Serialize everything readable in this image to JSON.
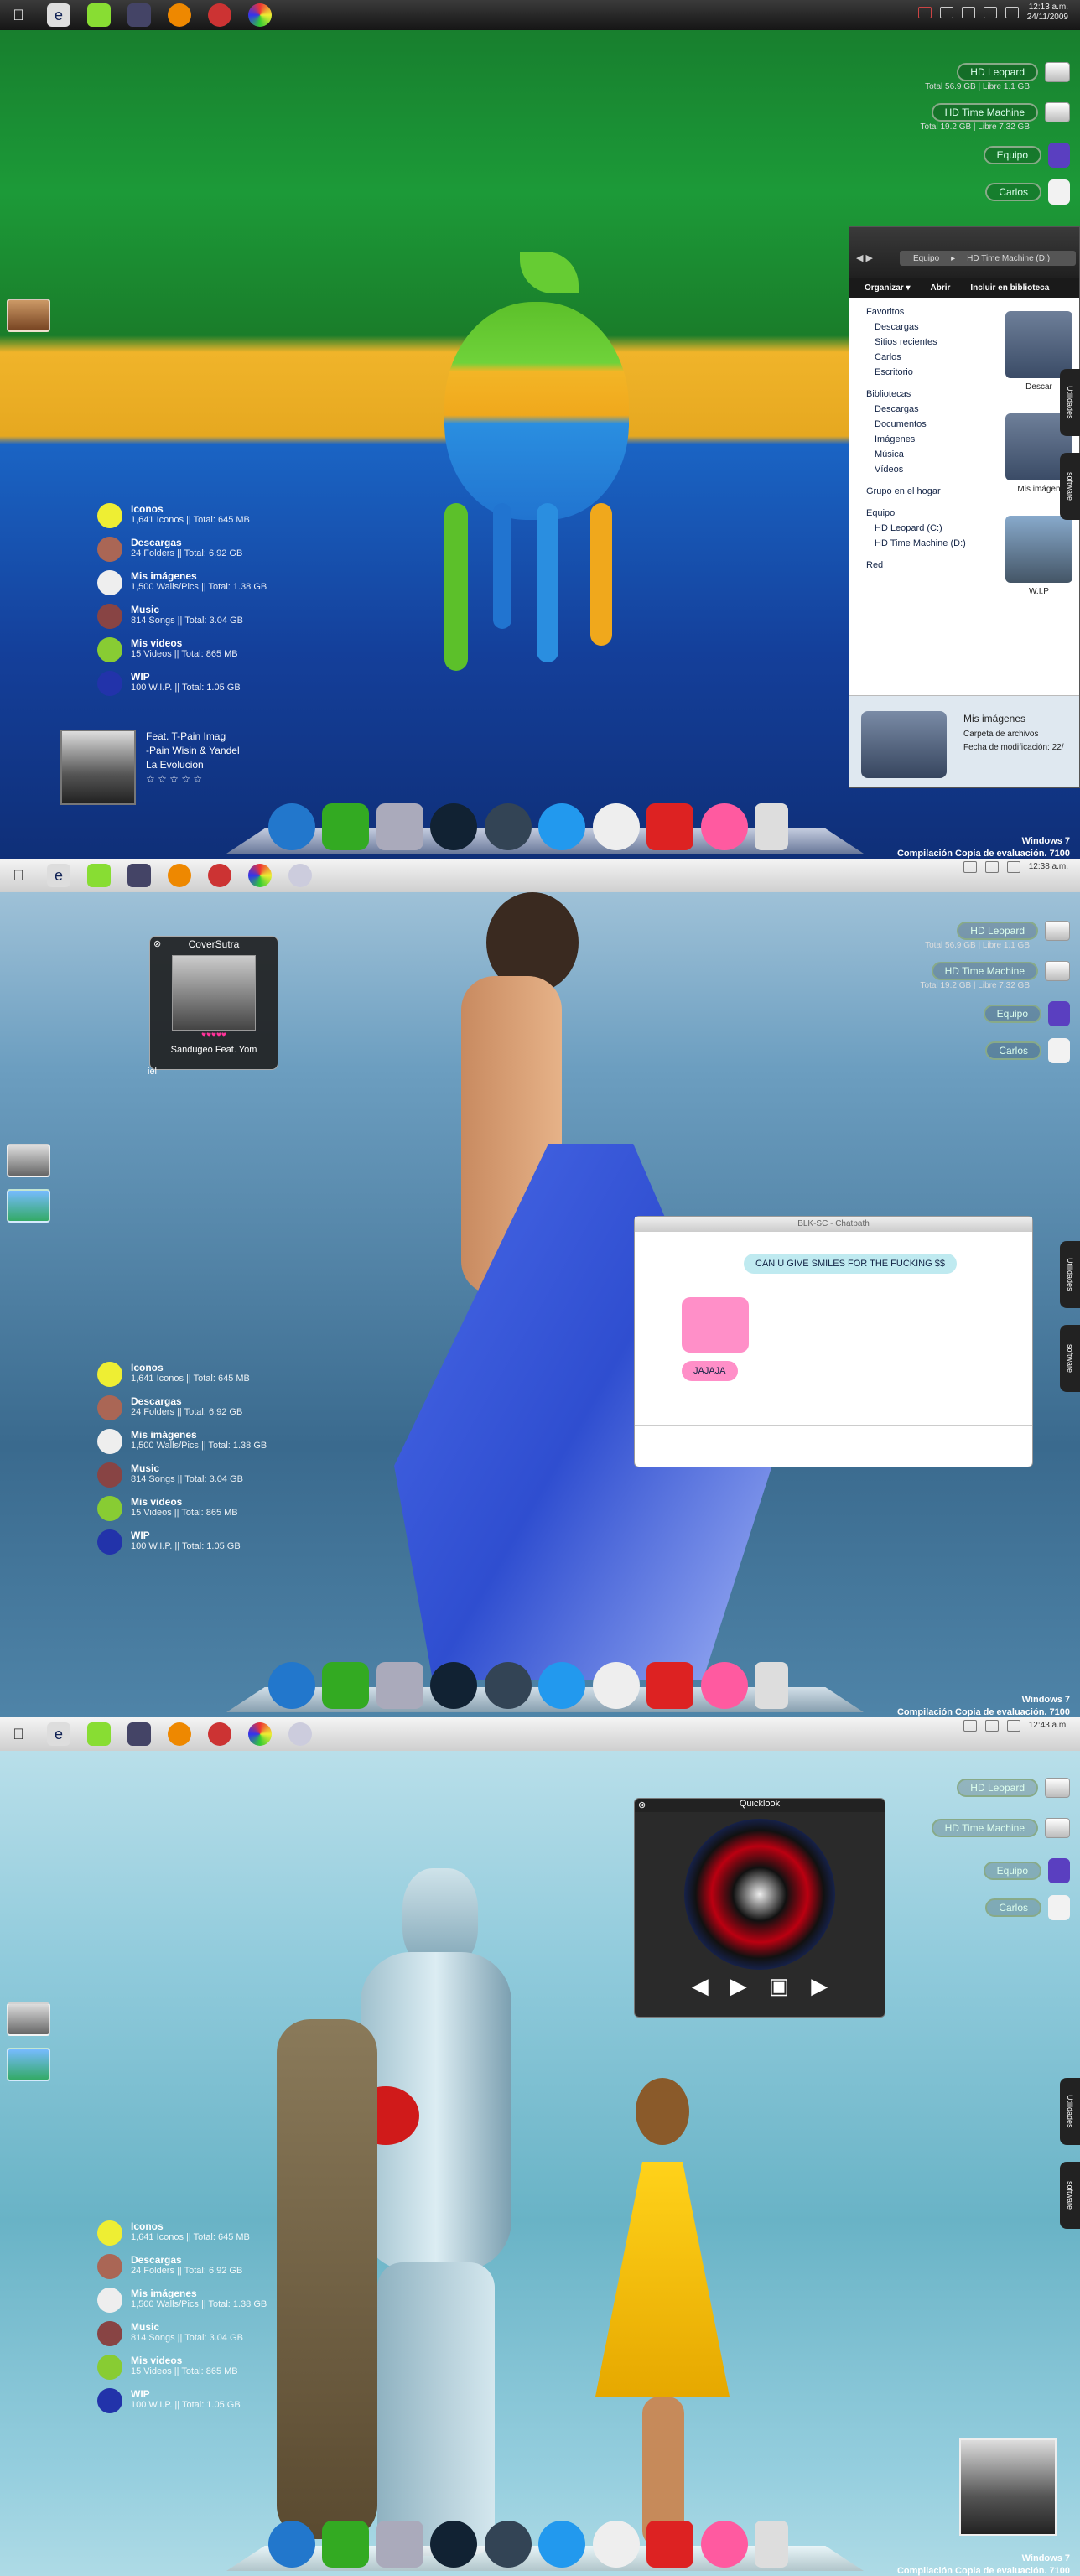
{
  "menubar": {
    "apple_icon": "apple-icon",
    "app_icons": [
      "ie-icon",
      "notes-icon",
      "monitor-icon",
      "firefox-icon",
      "chrome-icon",
      "pinwheel-icon"
    ]
  },
  "screen1": {
    "clock_time": "12:13 a.m.",
    "clock_date": "24/11/2009",
    "drives": [
      {
        "name": "HD Leopard",
        "sub": "Total 56.9 GB | Libre 1.1 GB"
      },
      {
        "name": "HD Time Machine",
        "sub": "Total 19.2 GB | Libre 7.32 GB"
      }
    ],
    "users": [
      "Equipo",
      "Carlos"
    ],
    "stats": [
      {
        "title": "Iconos",
        "detail": "1,641 Iconos || Total: 645 MB",
        "icon": "bulb-icon"
      },
      {
        "title": "Descargas",
        "detail": "24 Folders || Total: 6.92 GB",
        "icon": "download-icon"
      },
      {
        "title": "Mis imágenes",
        "detail": "1,500 Walls/Pics || Total: 1.38 GB",
        "icon": "images-icon"
      },
      {
        "title": "Music",
        "detail": "814 Songs || Total: 3.04 GB",
        "icon": "music-icon"
      },
      {
        "title": "Mis videos",
        "detail": "15 Videos || Total: 865 MB",
        "icon": "video-icon"
      },
      {
        "title": "WIP",
        "detail": "100 W.I.P. || Total: 1.05 GB",
        "icon": "wip-icon"
      }
    ],
    "music": {
      "line1": "Feat. T-Pain    Imag",
      "line2": "-Pain    Wisin & Yandel",
      "line3": "La Evolucion",
      "rating": "☆ ☆ ☆ ☆ ☆"
    },
    "explorer": {
      "addr_a": "Equipo",
      "addr_b": "HD Time Machine (D:)",
      "toolbar": [
        "Organizar ▾",
        "Abrir",
        "Incluir en biblioteca"
      ],
      "nav_favorites": "Favoritos",
      "favorites": [
        "Descargas",
        "Sitios recientes",
        "Carlos",
        "Escritorio"
      ],
      "nav_libraries": "Bibliotecas",
      "libraries": [
        "Descargas",
        "Documentos",
        "Imágenes",
        "Música",
        "Vídeos"
      ],
      "homegroup": "Grupo en el hogar",
      "nav_computer": "Equipo",
      "computer": [
        "HD Leopard (C:)",
        "HD Time Machine (D:)"
      ],
      "network": "Red",
      "files": [
        "Descar",
        "Mis imágen",
        "W.I.P"
      ],
      "detail_name": "Mis imágenes",
      "detail_type": "Carpeta de archivos",
      "detail_date": "Fecha de modificación: 22/"
    },
    "watermark_1": "Windows 7",
    "watermark_2": "Compilación Copia de evaluación. 7100",
    "side_tabs": [
      "Utilidades",
      "software"
    ]
  },
  "screen2": {
    "clock_time": "12:38 a.m.",
    "coversutra": {
      "title": "CoverSutra",
      "subtitle": "Sandugeo Feat. Yom",
      "left": "iel"
    },
    "chat": {
      "title": "BLK-SC - Chatpath",
      "msg1": "CAN U GIVE SMILES FOR THE FUCKING $$",
      "msg2": "JAJAJA"
    }
  },
  "screen3": {
    "clock_time": "12:43 a.m.",
    "quicklook": {
      "title": "Quicklook"
    }
  },
  "dock": [
    "face-icon",
    "hat-icon",
    "robot-icon",
    "compass-icon",
    "safari-icon",
    "paint-icon",
    "tux-icon",
    "truck-icon",
    "chat-icon",
    "trash-icon"
  ],
  "colors": {
    "dock_highlight": "#ff5aa0",
    "accent_green": "#1c9a38",
    "accent_blue": "#1a64c4"
  }
}
